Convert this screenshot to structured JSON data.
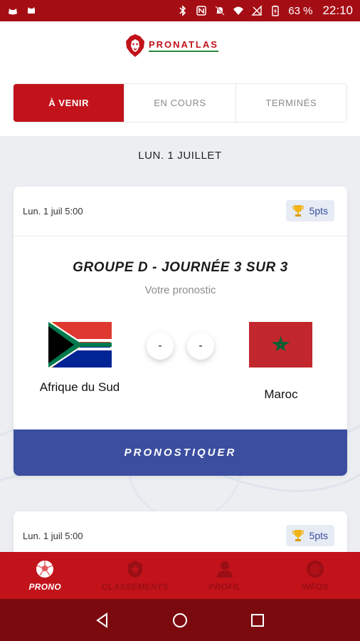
{
  "status_bar": {
    "battery": "63 %",
    "time": "22:10"
  },
  "brand": {
    "logo_text": "PRONATLAS",
    "primary_color": "#c2121a",
    "accent_color": "#3b4ea0"
  },
  "tabs": [
    {
      "label": "À VENIR",
      "active": true
    },
    {
      "label": "EN COURS",
      "active": false
    },
    {
      "label": "TERMINÉS",
      "active": false
    }
  ],
  "date_header": "LUN. 1 JUILLET",
  "matches": [
    {
      "date": "Lun. 1 juil 5:00",
      "points": "5pts",
      "group": "GROUPE D - JOURNÉE 3 SUR 3",
      "subtitle": "Votre pronostic",
      "home_team": "Afrique du Sud",
      "away_team": "Maroc",
      "home_score": "-",
      "away_score": "-",
      "cta": "PRONOSTIQUER"
    },
    {
      "date": "Lun. 1 juil 5:00",
      "points": "5pts"
    }
  ],
  "bottom_nav": [
    {
      "label": "PRONO",
      "icon": "soccer-ball-icon",
      "active": true
    },
    {
      "label": "CLASSEMENTS",
      "icon": "star-badge-icon",
      "active": false
    },
    {
      "label": "PROFIL",
      "icon": "person-icon",
      "active": false
    },
    {
      "label": "INFOS",
      "icon": "info-icon",
      "active": false
    }
  ]
}
